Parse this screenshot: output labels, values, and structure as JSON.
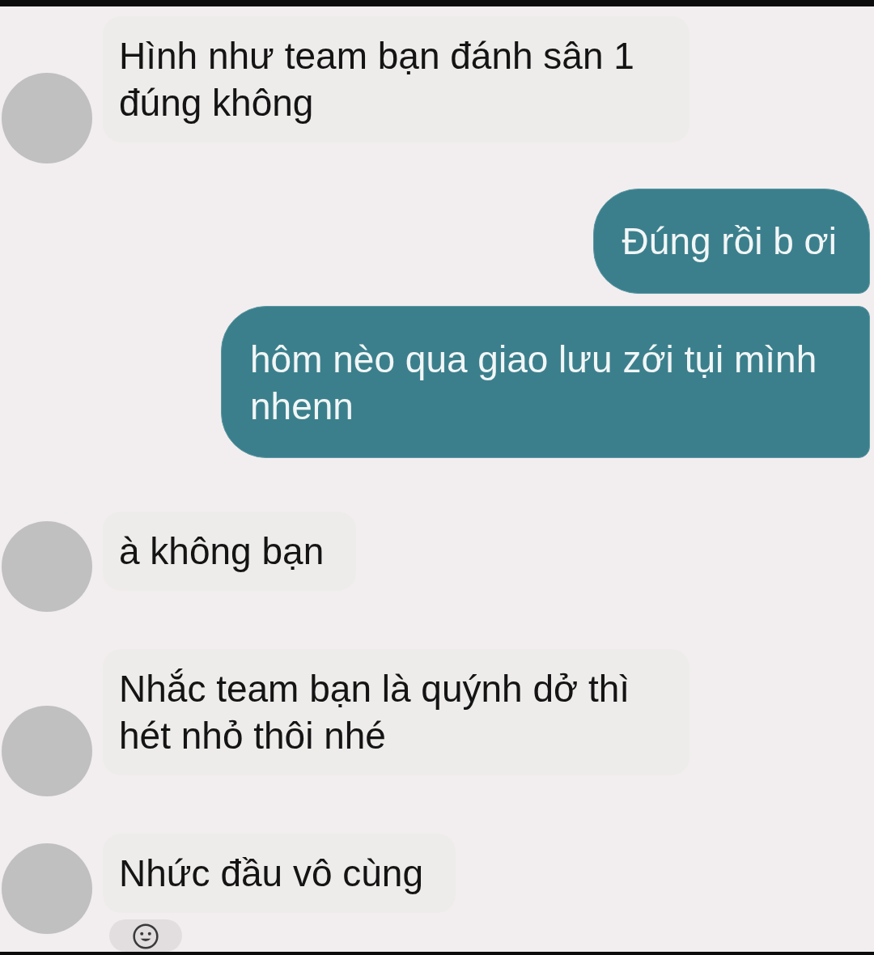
{
  "messages": [
    {
      "kind": "received",
      "text": "Hình như team bạn đánh sân 1 đúng không"
    },
    {
      "kind": "sent",
      "text": "Đúng rồi b ơi"
    },
    {
      "kind": "sent",
      "text": "hôm nèo qua giao lưu zới tụi mình nhenn"
    },
    {
      "kind": "received",
      "text": "à không bạn"
    },
    {
      "kind": "received",
      "text": "Nhắc team bạn là quýnh dở thì hét nhỏ thôi nhé"
    },
    {
      "kind": "received",
      "text": "Nhức đầu vô cùng"
    }
  ]
}
